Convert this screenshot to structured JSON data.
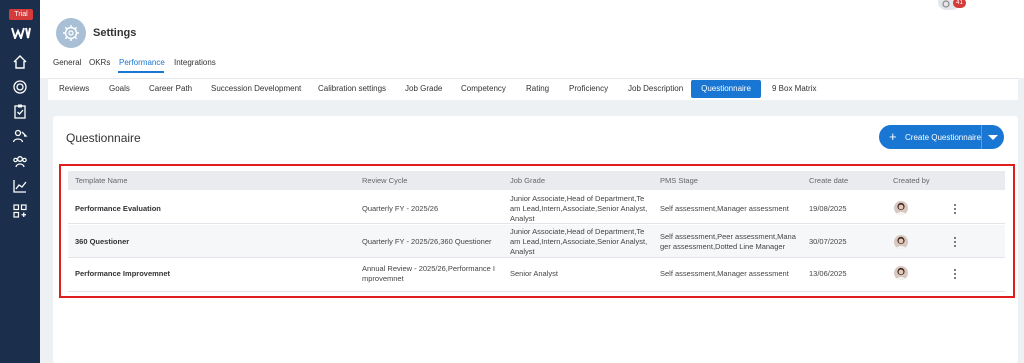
{
  "sidebar": {
    "trial_label": "Trial",
    "icons": [
      "home-icon",
      "target-icon",
      "clipboard-icon",
      "user-assign-icon",
      "team-icon",
      "chart-icon",
      "apps-icon"
    ]
  },
  "header": {
    "title": "Settings",
    "notification_count": "41",
    "tabs": [
      "General",
      "OKRs",
      "Performance",
      "Integrations"
    ],
    "active_tab": "Performance"
  },
  "subnav": {
    "tabs": [
      "Reviews",
      "Goals",
      "Career Path",
      "Succession Development",
      "Calibration settings",
      "Job Grade",
      "Competency",
      "Rating",
      "Proficiency",
      "Job Description",
      "Questionnaire",
      "9 Box Matrix"
    ],
    "active_tab": "Questionnaire"
  },
  "page": {
    "title": "Questionnaire",
    "create_button": "Create Questionnaire"
  },
  "table": {
    "columns": [
      "Template Name",
      "Review Cycle",
      "Job Grade",
      "PMS Stage",
      "Create date",
      "Created by"
    ],
    "rows": [
      {
        "template_name": "Performance Evaluation",
        "review_cycle": "Quarterly FY - 2025/26",
        "job_grade": [
          "Junior Associate,Head of Department,Te",
          "am Lead,Intern,Associate,Senior Analyst,",
          "Analyst"
        ],
        "pms_stage": [
          "Self assessment,Manager assessment"
        ],
        "create_date": "19/08/2025"
      },
      {
        "template_name": "360 Questioner",
        "review_cycle": "Quarterly FY - 2025/26,360 Questioner",
        "job_grade": [
          "Junior Associate,Head of Department,Te",
          "am Lead,Intern,Associate,Senior Analyst,",
          "Analyst"
        ],
        "pms_stage": [
          "Self assessment,Peer assessment,Mana",
          "ger assessment,Dotted Line Manager"
        ],
        "create_date": "30/07/2025"
      },
      {
        "template_name": "Performance Improvemnet",
        "review_cycle": [
          "Annual Review - 2025/26,Performance I",
          "mprovemnet"
        ],
        "job_grade": [
          "Senior Analyst"
        ],
        "pms_stage": [
          "Self assessment,Manager assessment"
        ],
        "create_date": "13/06/2025"
      }
    ]
  },
  "colors": {
    "accent": "#1976d2",
    "rail": "#1b2e4b",
    "highlight": "#e01e1e"
  }
}
